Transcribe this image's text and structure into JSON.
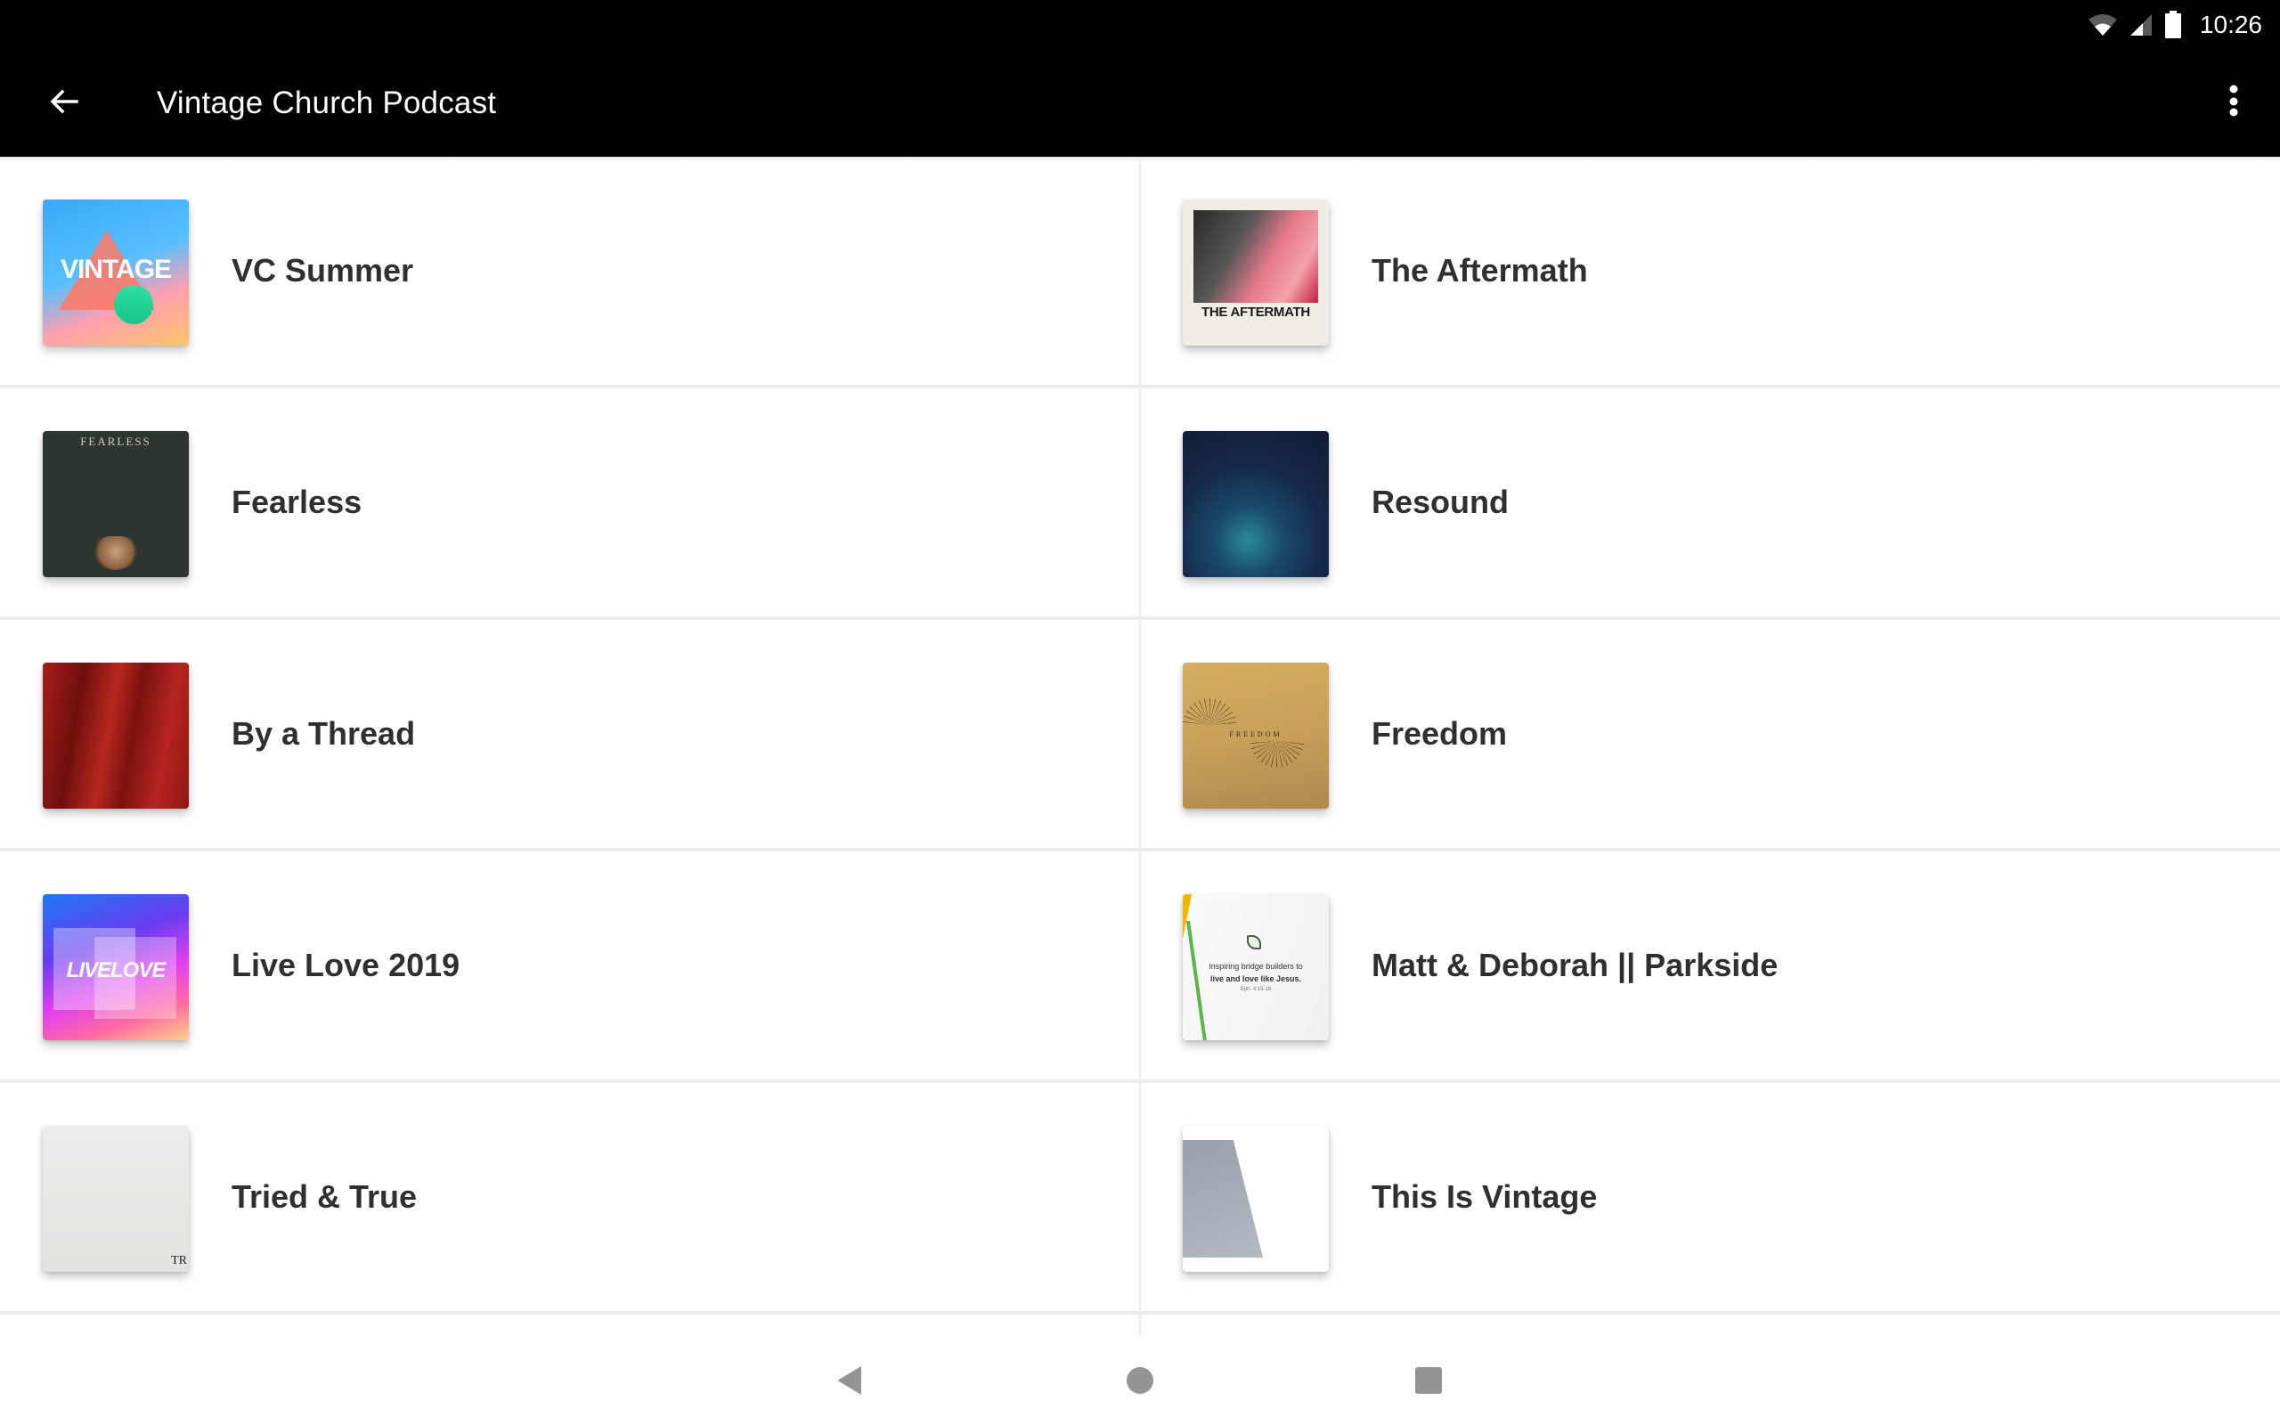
{
  "status_bar": {
    "time": "10:26",
    "icons": [
      "wifi-icon",
      "cell-signal-icon",
      "battery-icon"
    ]
  },
  "toolbar": {
    "title": "Vintage Church Podcast",
    "back_icon": "arrow-back-icon",
    "menu_icon": "more-vert-icon"
  },
  "podcasts": [
    {
      "title": "VC Summer",
      "art": {
        "text": "VINTAGE"
      }
    },
    {
      "title": "The Aftermath",
      "art": {
        "text": "THE AFTERMATH"
      }
    },
    {
      "title": "Fearless",
      "art": {
        "text": "FEARLESS"
      }
    },
    {
      "title": "Resound",
      "art": {
        "text": ""
      }
    },
    {
      "title": "By a Thread",
      "art": {
        "text": ""
      }
    },
    {
      "title": "Freedom",
      "art": {
        "text": "FREEDOM"
      }
    },
    {
      "title": "Live Love 2019",
      "art": {
        "text": "LIVELOVE"
      }
    },
    {
      "title": "Matt & Deborah || Parkside",
      "art": {
        "line1": "Inspiring bridge builders to",
        "line2": "live and love like Jesus.",
        "line3": "Eph. 4:15-16"
      }
    },
    {
      "title": "Tried & True",
      "art": {
        "text": "TR"
      }
    },
    {
      "title": "This Is Vintage",
      "art": {
        "text": ""
      }
    }
  ],
  "nav_bar": {
    "buttons": [
      "back",
      "home",
      "recents"
    ]
  },
  "colors": {
    "app_bar": "#000000",
    "title_text": "#2f2f2f",
    "divider": "#ececec",
    "nav_icon": "#949494"
  }
}
